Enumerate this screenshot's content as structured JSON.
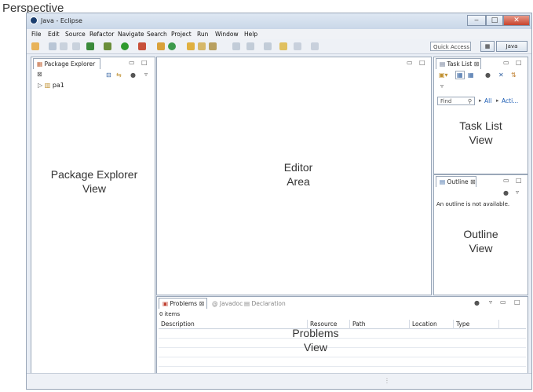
{
  "annotations": {
    "perspective": "Perspective",
    "package_explorer": "Package Explorer View",
    "editor": "Editor Area",
    "task_list": "Task List View",
    "outline": "Outline View",
    "problems": "Problems View"
  },
  "window": {
    "title": "Java - Eclipse",
    "minimize": "‒",
    "maximize": "□",
    "close": "✕"
  },
  "menu": [
    "File",
    "Edit",
    "Source",
    "Refactor",
    "Navigate",
    "Search",
    "Project",
    "Run",
    "Window",
    "Help"
  ],
  "toolbar": {
    "quick_access_placeholder": "Quick Access",
    "perspective_java": "Java"
  },
  "package_explorer": {
    "tab": "Package Explorer",
    "project": "pa1"
  },
  "task_list": {
    "tab": "Task List",
    "find_placeholder": "Find",
    "all_link": "All",
    "acti_link": "Acti..."
  },
  "outline": {
    "tab": "Outline",
    "message": "An outline is not available."
  },
  "problems": {
    "tabs": [
      "Problems",
      "Javadoc",
      "Declaration"
    ],
    "count": "0 items",
    "columns": [
      "Description",
      "Resource",
      "Path",
      "Location",
      "Type"
    ]
  },
  "colors": {
    "accent": "#1f5fb5",
    "border": "#9aa7b8",
    "background": "#e9eef5"
  }
}
